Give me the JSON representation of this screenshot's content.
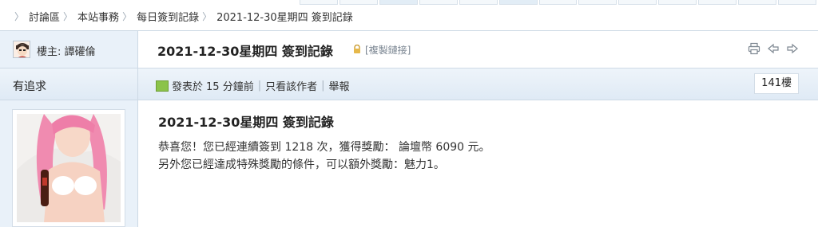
{
  "breadcrumb": {
    "items": [
      "討論區",
      "本站事務",
      "每日簽到記錄",
      "2021-12-30星期四 簽到記錄"
    ]
  },
  "thread": {
    "author_label": "樓主: 譚礶倫",
    "title": "2021-12-30星期四 簽到記錄",
    "copy_link": "[複製鏈接]"
  },
  "post": {
    "username": "有追求",
    "posted_prefix": "發表於",
    "posted_time": "15 分鐘前",
    "only_author": "只看該作者",
    "report": "舉報",
    "floor": "141樓",
    "title": "2021-12-30星期四 簽到記錄",
    "lines": [
      "恭喜您！您已經連續簽到 1218 次，獲得獎勵： 論壇幣 6090 元。",
      "另外您已經達成特殊獎勵的條件，可以額外獎勵：魅力1。"
    ]
  },
  "icons": {
    "print": "print-icon",
    "prev": "prev-arrow-icon",
    "next": "next-arrow-icon",
    "lock": "lock-icon"
  }
}
